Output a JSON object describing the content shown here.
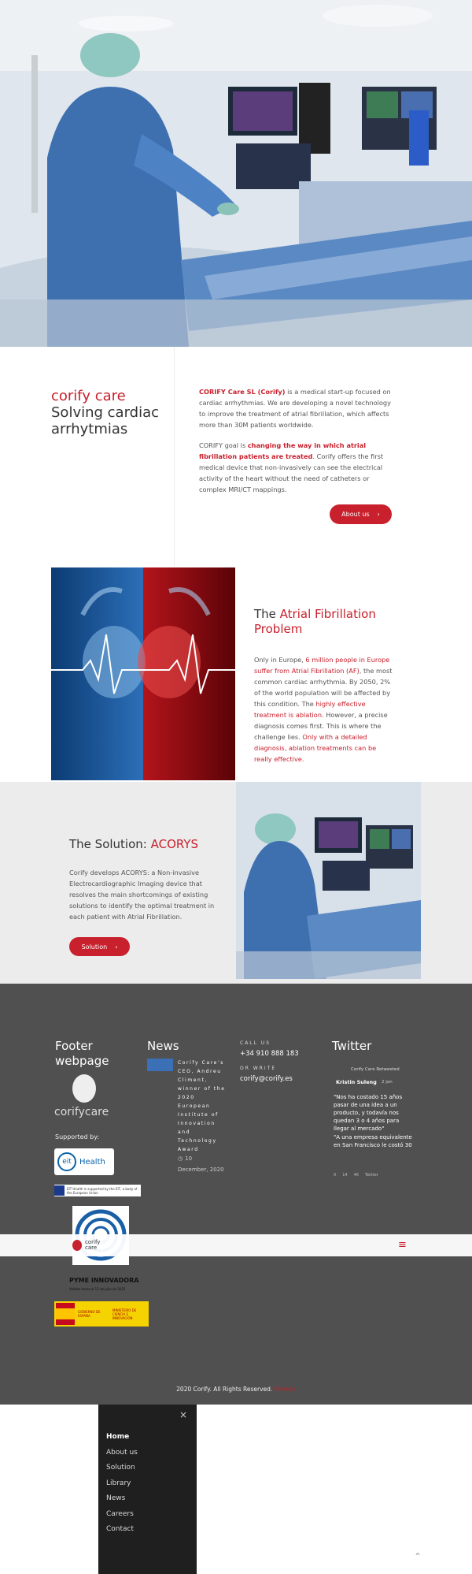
{
  "intro": {
    "brand": "corify care",
    "title_line1": "Solving cardiac",
    "title_line2": "arrhytmias",
    "p1_strong": "CORIFY Care SL (Corify)",
    "p1_rest": " is a medical start-up focused on cardiac arrhythmias. We are developing a novel technology to improve the treatment of atrial fibrillation, which affects more than 30M patients worldwide.",
    "p2_start": "CORIFY goal is ",
    "p2_strong": "changing the way in which atrial fibrillation patients are treated",
    "p2_rest": ". Corify offers the first medical device that non-invasively can see the electrical activity of the heart without the need of catheters or complex MRI/CT mappings.",
    "button_label": "About us"
  },
  "af": {
    "title_pre": "The ",
    "title_red": "Atrial Fibrillation Problem",
    "p_a": "Only in Europe, ",
    "p_b": "6 million people in Europe suffer from Atrial Fibrillation (AF)",
    "p_c": ", the most common cardiac arrhythmia. By 2050, 2% of the world population will be affected by this condition. The ",
    "p_d": "highly effective treatment is ablation",
    "p_e": ". However, a precise diagnosis comes first. This is where the challenge lies. ",
    "p_f": "Only with a detailed diagnosis, ablation treatments can be really effective."
  },
  "solution": {
    "title_pre": "The Solution: ",
    "title_red": "ACORYS",
    "text": "Corify develops ACORYS: a Non-invasive Electrocardiographic Imaging device that resolves the main shortcomings of existing solutions to identify the optimal treatment in each patient with Atrial Fibrillation.",
    "button_label": "Solution"
  },
  "footer": {
    "col1_title": "Footer webpage",
    "logo_text": "corifycare",
    "supported_by": "Supported by:",
    "eit_label": "Health",
    "eu_text": "EIT Health is supported by the EIT, a body of the European Union",
    "pyme_title": "PYME INNOVADORA",
    "pyme_sub": "Validez hasta el 12 de Julio de 2022",
    "ministry_1": "GOBIERNO DE ESPAÑA",
    "ministry_2": "MINISTERIO DE CIENCIA E INNOVACIÓN",
    "news_title": "News",
    "news_text": "Corify Care's CEO, Andreu Climent, winner of the 2020 European Institute of Innovation and Technology Award",
    "news_comments": "10",
    "news_date": "December, 2020",
    "call_label": "CALL US",
    "phone": "+34 910 888 183",
    "write_label": "OR WRITE",
    "email": "corify@corify.es",
    "twitter_title": "Twitter",
    "retweeted": "Corify Care Retweeted",
    "tw_author": "Kristin Suleng",
    "tw_time": "2 Jan",
    "tw_text1": "\"Nos ha costado 15 años pasar de una idea a un producto, y todavía nos quedan 3 o 4 años para llegar al mercado\"",
    "tw_text2": "\"A una empresa equivalente en San Francisco le costó 30",
    "tw_c1": "0",
    "tw_c2": "14",
    "tw_c3": "46",
    "tw_label": "Twitter",
    "copyright": "2020 Corify. All Rights Reserved.",
    "copyright_link": "Privacy"
  },
  "sticky_logo": "corify care",
  "menu": {
    "items": [
      "Home",
      "About us",
      "Solution",
      "Library",
      "News",
      "Careers",
      "Contact"
    ]
  }
}
